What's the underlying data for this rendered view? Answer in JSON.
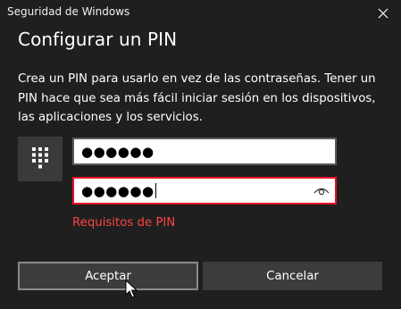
{
  "window": {
    "title": "Seguridad de Windows"
  },
  "dialog": {
    "heading": "Configurar un PIN",
    "description": "Crea un PIN para usarlo en vez de las contraseñas. Tener un PIN hace que sea más fácil iniciar sesión en los dispositivos, las aplicaciones y los servicios."
  },
  "pin_field": {
    "masked_value": "●●●●●●"
  },
  "confirm_field": {
    "masked_value": "●●●●●●",
    "state": "error"
  },
  "pin_requirements_link": "Requisitos de PIN",
  "buttons": {
    "accept_label": "Aceptar",
    "cancel_label": "Cancelar"
  },
  "icons": {
    "close": "close-icon",
    "keypad": "keypad-icon",
    "reveal": "eye-icon",
    "cursor": "mouse-pointer-icon"
  },
  "colors": {
    "background": "#1f1f1f",
    "error": "#e81123",
    "link_error": "#ff4343",
    "button": "#3c3c3c"
  }
}
